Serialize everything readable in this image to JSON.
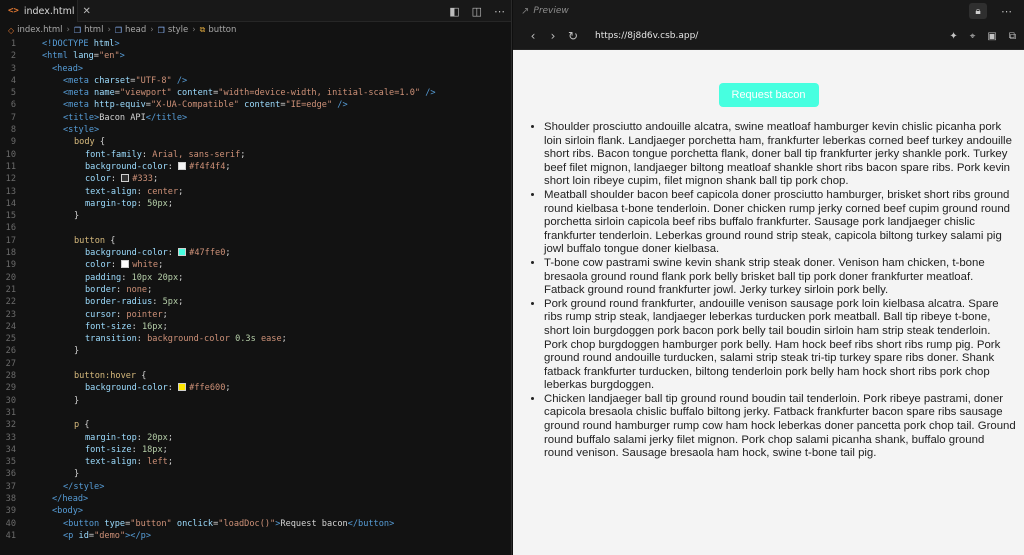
{
  "editor": {
    "tab_name": "index.html",
    "tab_file_icon": "<>",
    "breadcrumb": [
      {
        "icon": "html-file-icon",
        "label": "index.html"
      },
      {
        "icon": "box-icon",
        "label": "html"
      },
      {
        "icon": "box-icon",
        "label": "head"
      },
      {
        "icon": "box-icon",
        "label": "style"
      },
      {
        "icon": "tag-icon",
        "label": "button"
      }
    ],
    "line_numbers": [
      "1",
      "2",
      "3",
      "4",
      "5",
      "6",
      "7",
      "8",
      "9",
      "10",
      "11",
      "12",
      "13",
      "14",
      "15",
      "16",
      "17",
      "18",
      "19",
      "20",
      "21",
      "22",
      "23",
      "24",
      "25",
      "26",
      "27",
      "28",
      "29",
      "30",
      "31",
      "32",
      "33",
      "34",
      "35",
      "36",
      "37",
      "38",
      "39",
      "40",
      "41"
    ],
    "swatches": {
      "f4f4f4": "#f4f4f4",
      "333": "#333333",
      "47ffe0": "#47ffe0",
      "white": "#ffffff",
      "ffe600": "#ffe600"
    },
    "code": {
      "l1": [
        "<!DOCTYPE ",
        "html",
        ">"
      ],
      "l2": [
        "<html ",
        "lang",
        "=",
        "\"en\"",
        ">"
      ],
      "l3": [
        "<head>"
      ],
      "l4": [
        "<meta ",
        "charset",
        "=",
        "\"UTF-8\"",
        " />"
      ],
      "l5": [
        "<meta ",
        "name",
        "=",
        "\"viewport\"",
        " ",
        "content",
        "=",
        "\"width=device-width, initial-scale=1.0\"",
        " />"
      ],
      "l6": [
        "<meta ",
        "http-equiv",
        "=",
        "\"X-UA-Compatible\"",
        " ",
        "content",
        "=",
        "\"IE=edge\"",
        " />"
      ],
      "l7": [
        "<title>",
        "Bacon API",
        "</title>"
      ],
      "l8": [
        "<style>"
      ],
      "l9": [
        "body",
        " {"
      ],
      "l10": [
        "font-family",
        ": ",
        "Arial, sans-serif",
        ";"
      ],
      "l11": [
        "background-color",
        ": ",
        "#f4f4f4",
        ";"
      ],
      "l12": [
        "color",
        ": ",
        "#333",
        ";"
      ],
      "l13": [
        "text-align",
        ": ",
        "center",
        ";"
      ],
      "l14": [
        "margin-top",
        ": ",
        "50px",
        ";"
      ],
      "l15": [
        "}"
      ],
      "l16": [
        ""
      ],
      "l17": [
        "button",
        " {"
      ],
      "l18": [
        "background-color",
        ": ",
        "#47ffe0",
        ";"
      ],
      "l19": [
        "color",
        ": ",
        "white",
        ";"
      ],
      "l20": [
        "padding",
        ": ",
        "10px 20px",
        ";"
      ],
      "l21": [
        "border",
        ": ",
        "none",
        ";"
      ],
      "l22": [
        "border-radius",
        ": ",
        "5px",
        ";"
      ],
      "l23": [
        "cursor",
        ": ",
        "pointer",
        ";"
      ],
      "l24": [
        "font-size",
        ": ",
        "16px",
        ";"
      ],
      "l25": [
        "transition",
        ": ",
        "background-color ",
        "0.3s",
        " ease",
        ";"
      ],
      "l26": [
        "}"
      ],
      "l27": [
        ""
      ],
      "l28": [
        "button:hover",
        " {"
      ],
      "l29": [
        "background-color",
        ": ",
        "#ffe600",
        ";"
      ],
      "l30": [
        "}"
      ],
      "l31": [
        ""
      ],
      "l32": [
        "p",
        " {"
      ],
      "l33": [
        "margin-top",
        ": ",
        "20px",
        ";"
      ],
      "l34": [
        "font-size",
        ": ",
        "18px",
        ";"
      ],
      "l35": [
        "text-align",
        ": ",
        "left",
        ";"
      ],
      "l36": [
        "}"
      ],
      "l37": [
        "</style>"
      ],
      "l38": [
        "</head>"
      ],
      "l39": [
        "<body>"
      ],
      "l40": [
        "<button ",
        "type",
        "=",
        "\"button\"",
        " ",
        "onclick",
        "=",
        "\"loadDoc()\"",
        ">",
        "Request bacon",
        "</button>"
      ],
      "l41": [
        "<p ",
        "id",
        "=",
        "\"demo\"",
        "></p>"
      ]
    }
  },
  "preview": {
    "title": "Preview",
    "url": "https://8j8d6v.csb.app/",
    "button_label": "Request bacon",
    "paragraphs": [
      "Shoulder prosciutto andouille alcatra, swine meatloaf hamburger kevin chislic picanha pork loin sirloin flank. Landjaeger porchetta ham, frankfurter leberkas corned beef turkey andouille short ribs. Bacon tongue porchetta flank, doner ball tip frankfurter jerky shankle pork. Turkey beef filet mignon, landjaeger biltong meatloaf shankle short ribs bacon spare ribs. Pork kevin short loin ribeye cupim, filet mignon shank ball tip pork chop.",
      "Meatball shoulder bacon beef capicola doner prosciutto hamburger, brisket short ribs ground round kielbasa t-bone tenderloin. Doner chicken rump jerky corned beef cupim ground round porchetta sirloin capicola beef ribs buffalo frankfurter. Sausage pork landjaeger chislic frankfurter tenderloin. Leberkas ground round strip steak, capicola biltong turkey salami pig jowl buffalo tongue doner kielbasa.",
      "T-bone cow pastrami swine kevin shank strip steak doner. Venison ham chicken, t-bone bresaola ground round flank pork belly brisket ball tip pork doner frankfurter meatloaf. Fatback ground round frankfurter jowl. Jerky turkey sirloin pork belly.",
      "Pork ground round frankfurter, andouille venison sausage pork loin kielbasa alcatra. Spare ribs rump strip steak, landjaeger leberkas turducken pork meatball. Ball tip ribeye t-bone, short loin burgdoggen pork bacon pork belly tail boudin sirloin ham strip steak tenderloin. Pork chop burgdoggen hamburger pork belly. Ham hock beef ribs short ribs rump pig. Pork ground round andouille turducken, salami strip steak tri-tip turkey spare ribs doner. Shank fatback frankfurter turducken, biltong tenderloin pork belly ham hock short ribs pork chop leberkas burgdoggen.",
      "Chicken landjaeger ball tip ground round boudin tail tenderloin. Pork ribeye pastrami, doner capicola bresaola chislic buffalo biltong jerky. Fatback frankfurter bacon spare ribs sausage ground round hamburger rump cow ham hock leberkas doner pancetta pork chop tail. Ground round buffalo salami jerky filet mignon. Pork chop salami picanha shank, buffalo ground round venison. Sausage bresaola ham hock, swine t-bone tail pig."
    ]
  }
}
